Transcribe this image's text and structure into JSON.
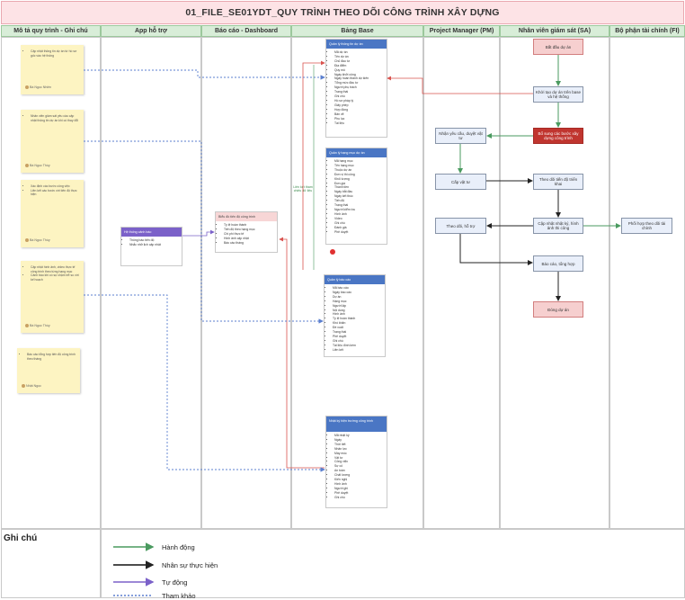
{
  "title": "01_FILE_SE01YDT_QUY TRÌNH THEO DÕI CÔNG TRÌNH XÂY DỰNG",
  "lanes": [
    {
      "label": "Mô tả quy trình - Ghi chú"
    },
    {
      "label": "App hỗ trợ"
    },
    {
      "label": "Báo cáo - Dashboard"
    },
    {
      "label": "Bảng Base"
    },
    {
      "label": "Project Manager (PM)"
    },
    {
      "label": "Nhân viên giám sát (SA)"
    },
    {
      "label": "Bộ phận tài chính (FI)"
    }
  ],
  "notes": [
    {
      "lines": [
        "Cập nhật thông tin dự án từ hồ sơ gốc vào hệ thống"
      ],
      "author": "Bà Ngọc Nhiên"
    },
    {
      "lines": [
        "Nhân viên giám sát yêu cầu cập nhật thông tin dự án khi có thay đổi"
      ],
      "author": "Bà Ngọc Thùy"
    },
    {
      "lines": [
        "Xác định các bước công việc",
        "Liên kết các bước với tiến độ thực hiện"
      ],
      "author": "Bà Ngọc Thùy"
    },
    {
      "lines": [
        "Cập nhật hình ảnh, video thực tế công trình theo từng hạng mục",
        "Cảnh báo khi có sự chậm trễ so với kế hoạch"
      ],
      "author": "Bà Ngọc Thùy"
    },
    {
      "lines": [
        "Báo cáo tổng hợp tiến độ công trình theo tháng"
      ],
      "author": "Nhật Ngọc"
    }
  ],
  "app_card": {
    "title": "Hệ thống cảnh báo",
    "items": [
      "Thông báo tiến độ",
      "Nhắc nhở lịch cập nhật"
    ]
  },
  "dash_card": {
    "title": "Biểu đồ tiến độ công trình",
    "items": [
      "Tỷ lệ hoàn thành",
      "Tiến độ theo hạng mục",
      "Chi phí thực tế",
      "Hình ảnh cập nhật",
      "Báo cáo tháng"
    ]
  },
  "base_cards": [
    {
      "title": "Quản lý thông tin dự án",
      "items": [
        "Mã dự án",
        "Tên dự án",
        "Chủ đầu tư",
        "Địa điểm",
        "Quy mô",
        "Ngày khởi công",
        "Ngày hoàn thành dự kiến",
        "Tổng mức đầu tư",
        "Người phụ trách",
        "Trạng thái",
        "Ghi chú",
        "Hồ sơ pháp lý",
        "Giấy phép",
        "Hợp đồng",
        "Bản vẽ",
        "Phụ lục",
        "Tài liệu"
      ]
    },
    {
      "title": "Quản lý hạng mục dự án",
      "items": [
        "Mã hạng mục",
        "Tên hạng mục",
        "Thuộc dự án",
        "Đơn vị thi công",
        "Khối lượng",
        "Đơn giá",
        "Thành tiền",
        "Ngày bắt đầu",
        "Ngày kết thúc",
        "Tiến độ",
        "Trạng thái",
        "Người kiểm tra",
        "Hình ảnh",
        "Video",
        "Ghi chú",
        "Đánh giá",
        "Phê duyệt"
      ]
    },
    {
      "title": "Quản lý báo cáo",
      "items": [
        "Mã báo cáo",
        "Ngày báo cáo",
        "Dự án",
        "Hạng mục",
        "Người lập",
        "Nội dung",
        "Hình ảnh",
        "Tỷ lệ hoàn thành",
        "Khó khăn",
        "Đề xuất",
        "Trạng thái",
        "Phê duyệt",
        "Ghi chú",
        "Tài liệu đính kèm",
        "Liên kết"
      ]
    },
    {
      "title": "Nhật ký hiện trường công trình",
      "items": [
        "Mã nhật ký",
        "Ngày",
        "Thời tiết",
        "Nhân lực",
        "Máy móc",
        "Vật tư",
        "Công việc",
        "Sự cố",
        "An toàn",
        "Chất lượng",
        "Kiến nghị",
        "Hình ảnh",
        "Người ghi",
        "Phê duyệt",
        "Ghi chú"
      ]
    }
  ],
  "link_label": "Liên kết tham chiếu dữ liệu",
  "boxes": {
    "start": "Bắt đầu dự án",
    "create": "Khởi tạo dự án trên base và hệ thống",
    "update_steps": "Bổ sung các bước xây dựng công trình",
    "pm_request": "Nhận yêu cầu, duyệt vật tư",
    "supply": "Cấp vật tư",
    "track": "Theo dõi tiến độ triển khai",
    "pm_follow": "Theo dõi, hỗ trợ",
    "diary": "Cập nhật nhật ký, hình ảnh thi công",
    "finance": "Phối hợp theo dõi tài chính",
    "report": "Báo cáo, tổng hợp",
    "end": "Đóng dự án"
  },
  "legend": {
    "title": "Ghi chú",
    "items": [
      {
        "label": "Hành động",
        "color": "#4a9a5f"
      },
      {
        "label": "Nhân sự thực hiện",
        "color": "#111111"
      },
      {
        "label": "Tự động",
        "color": "#7b61c9"
      },
      {
        "label": "Tham khảo",
        "color": "#5b7fcf"
      }
    ]
  }
}
